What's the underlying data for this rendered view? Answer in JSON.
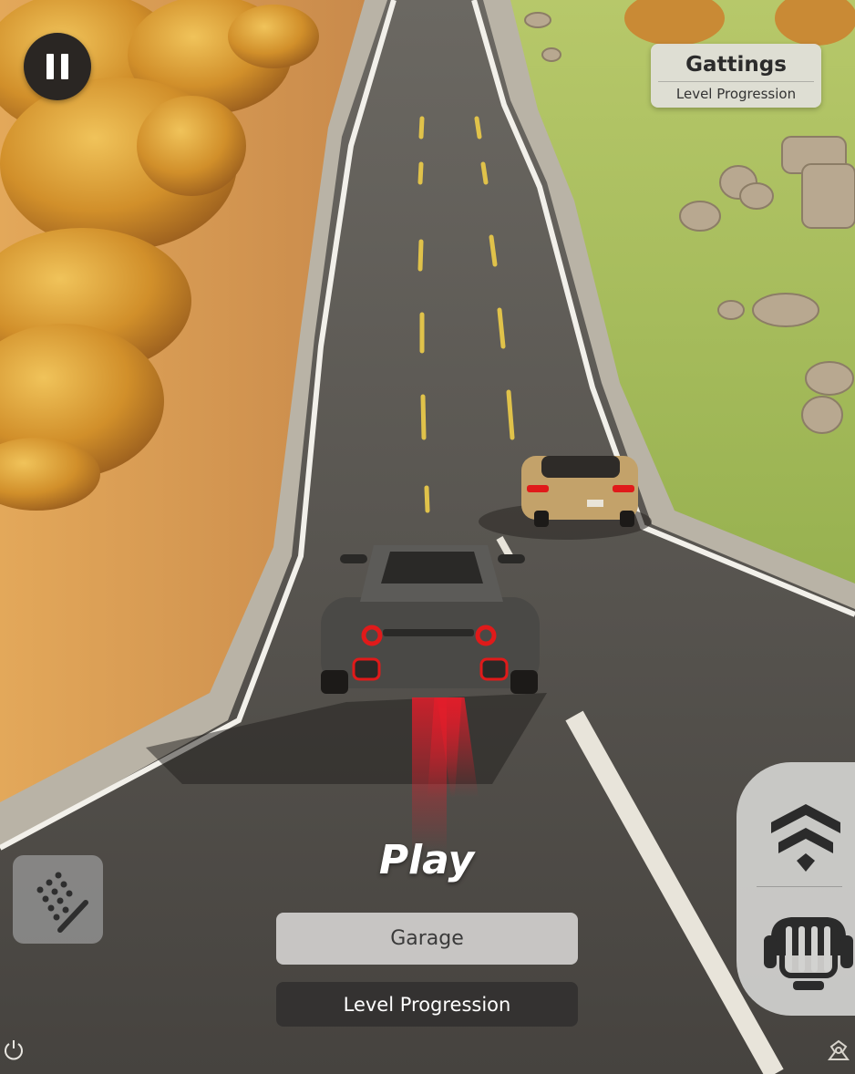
{
  "game": {
    "view": "third-person chase camera on a winding two-lane road",
    "play_label": "Play",
    "garage_label": "Garage",
    "level_progression_label": "Level Progression"
  },
  "settings_panel": {
    "title": "Gattings",
    "subtitle": "Level Progression"
  },
  "icons": {
    "pause": "pause-icon",
    "dpad": "dpad-icon",
    "boost": "boost-chevron-icon",
    "brake": "brake-icon",
    "power": "power-icon",
    "corner": "decorative-corner-icon"
  },
  "colors": {
    "road": "#5a5752",
    "grass": "#8fb04a",
    "foliage": "#d7a03c",
    "player_car": "#4a4946",
    "rival_car": "#c3a26a",
    "tail_light": "#e01a1a"
  }
}
